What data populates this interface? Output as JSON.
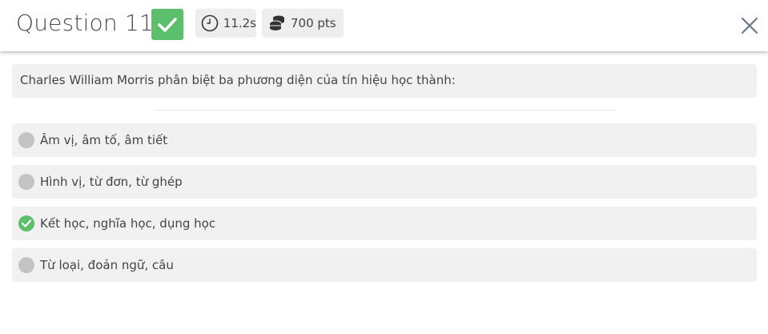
{
  "header": {
    "title": "Question 11",
    "status_icon": "check-icon",
    "time_label": "11.2s",
    "points_label": "700 pts"
  },
  "question": {
    "text": "Charles William Morris phân biệt ba phương diện của tín hiệu học thành:"
  },
  "options": [
    {
      "label": "Âm vị, âm tố, âm tiết",
      "state": "unselected"
    },
    {
      "label": "Hình vị, từ đơn, từ ghép",
      "state": "unselected"
    },
    {
      "label": "Kết học, nghĩa học, dụng học",
      "state": "correct"
    },
    {
      "label": "Từ loại, đoản ngữ, câu",
      "state": "unselected"
    }
  ],
  "colors": {
    "correct": "#5cbf6c",
    "neutral_radio": "#c4c4c4",
    "option_bg": "#f1f1f1"
  }
}
